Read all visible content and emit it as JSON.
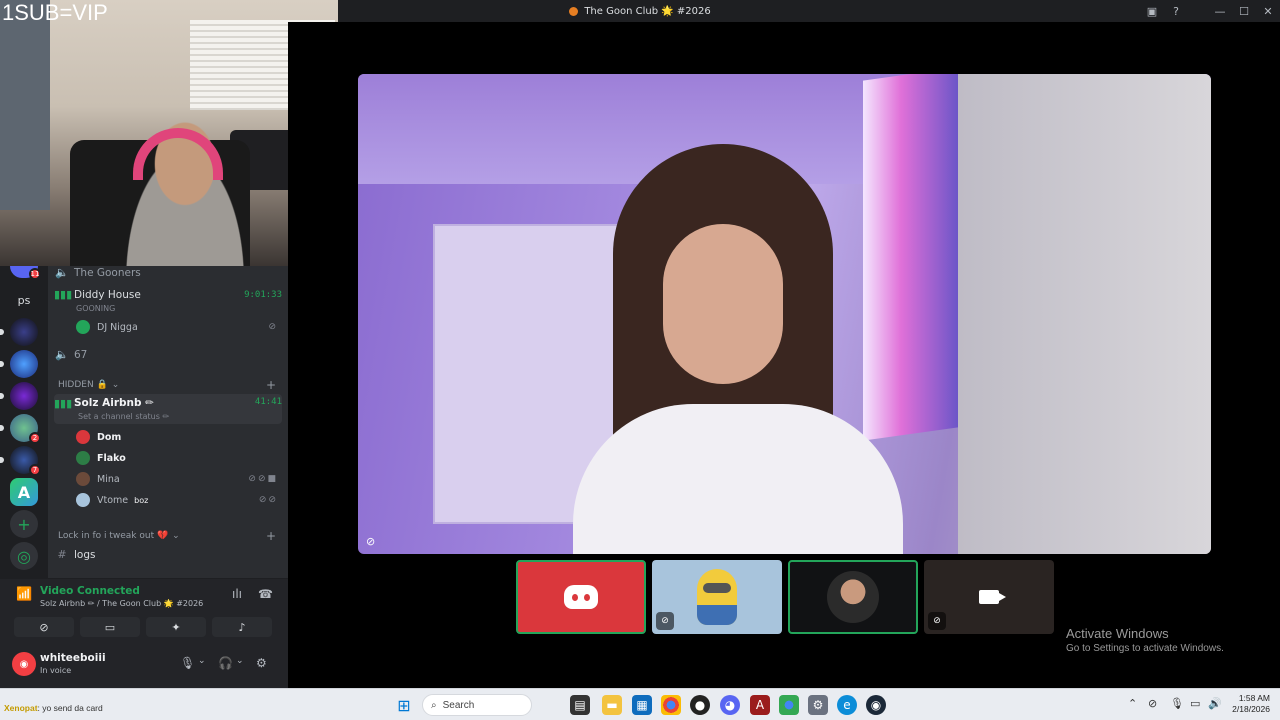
{
  "window": {
    "title": "The Goon Club 🌟 #2026"
  },
  "overlay": {
    "text": "1SUB=VIP"
  },
  "servers": {
    "ps_label": "ps",
    "badges": [
      "11",
      "2",
      "7"
    ]
  },
  "channels": {
    "gooners": "The Gooners",
    "diddy_house": {
      "name": "Diddy House",
      "status": "GOONING",
      "timer": "9:01:33"
    },
    "diddy_user": "DJ Nigga",
    "voice_67": "67",
    "category_hidden": "HIDDEN 🔒",
    "solz": {
      "name": "Solz Airbnb ✏",
      "status": "Set a channel status ✏",
      "timer": "41:41"
    },
    "solz_users": [
      {
        "name": "Dom",
        "color": "#da373c"
      },
      {
        "name": "Flako",
        "color": "#2d7d46"
      },
      {
        "name": "Mina",
        "color": "#6b4a3a"
      },
      {
        "name": "Vtome",
        "badge": "boz",
        "color": "#a8c4dc"
      }
    ],
    "category_lock": "Lock in fo i tweak out 💔",
    "logs": "logs"
  },
  "voice_panel": {
    "title": "Video Connected",
    "subtitle": "Solz Airbnb ✏ / The Goon Club 🌟 #2026"
  },
  "user_panel": {
    "name": "whiteeboiii",
    "status": "In voice"
  },
  "watermark": {
    "line1": "Activate Windows",
    "line2": "Go to Settings to activate Windows."
  },
  "taskbar": {
    "chat_name": "Xenopat",
    "chat_text": ": yo send da card",
    "search_placeholder": "Search",
    "time": "1:58 AM",
    "date": "2/18/2026"
  },
  "colors": {
    "discord_green": "#23a55a",
    "discord_red": "#da373c",
    "sidebar_bg": "#2b2d31"
  }
}
